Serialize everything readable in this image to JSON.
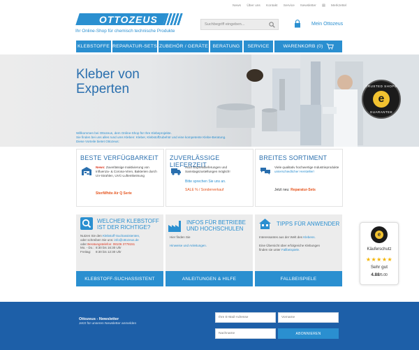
{
  "topnav": {
    "links": [
      "News",
      "Über uns",
      "Kontakt",
      "Service",
      "Newsletter"
    ],
    "merkzettel": "Merkzettel"
  },
  "logo": {
    "text": "OTTOZEUS"
  },
  "tagline": "Ihr Online-Shop für chemisch technische Produkte",
  "search": {
    "placeholder": "Suchbegriff eingeben..."
  },
  "account": {
    "label": "Mein Ottozeus"
  },
  "mainnav": {
    "items": [
      "KLEBSTOFFE",
      "REPARATUR-SETS",
      "ZUBEHÖR / GERÄTE",
      "BERATUNG",
      "SERVICE",
      "WARENKORB (0)"
    ]
  },
  "hero": {
    "title_line1": "Kleber von",
    "title_line2": "Experten",
    "text_line1": "Willkommen bei Ottozeus, dem Online-Shop für Ihre Klebeprojekte.",
    "text_line2": "Sie finden bei uns alles rund ums Kleben: Kleber, Klebstoffzubehör und eine kompetente Klebe-Beratung.",
    "text_line3": "Diese Vorteile bietet Ottozeus:"
  },
  "trusted_badge": {
    "top": "TRUSTED SHOPS",
    "bottom": "GUARANTEE",
    "mark": "e"
  },
  "cards": [
    {
      "title": "BESTE VERFÜGBARKEIT",
      "news_label": "News:",
      "body": "Zuverlässige Inaktivierung von Influenza- & Corona-Viren, Bakterien durch UV-Strahlen, UVC-Luftentkeimung",
      "link": "SteriWhite Air Q Serie"
    },
    {
      "title": "ZUVERLÄSSIGE LIEFERZEIT",
      "body": "Auch Expresslieferungen und Samstagszustellungen möglich!",
      "link1": "Bitte sprechen Sie uns an.",
      "link2": "SALE % / Sonderverkauf"
    },
    {
      "title": "BREITES SORTIMENT",
      "body": "Viele qualitativ hochwertige Industrieprodukte",
      "body_link": "unterschiedlicher Hersteller!",
      "now_label": "Jetzt neu:",
      "link": "Reparatur-Sets"
    }
  ],
  "panels": [
    {
      "title_line1": "WELCHER KLEBSTOFF",
      "title_line2": "IST DER RICHTIGE?",
      "line1_pre": "Nutzen Sie den",
      "line1_link": "Klebstoff-Suchassistenten,",
      "line2_pre": "oder schreiben Sie uns:",
      "line2_link": "info@ottozeus.de",
      "line3_pre": "oder",
      "line3_link": "Beratungstelefon: 08106 3778151",
      "hours1_label": "Mo. - Do.:",
      "hours1": "8:30 bis 16:30 Uhr",
      "hours2_label": "Freitag:",
      "hours2": "8:30 bis 12:30 Uhr",
      "button": "KLEBSTOFF-SUCHASSISTENT"
    },
    {
      "title_line1": "INFOS FÜR BETRIEBE",
      "title_line2": "UND HOCHSCHULEN",
      "line1": "Hier finden Sie",
      "line2_link": "Hinweise und Anleitungen.",
      "button": "ANLEITUNGEN & HILFE"
    },
    {
      "title_line1": "TIPPS FÜR ANWENDER",
      "line1_pre": "Interessantes aus der Welt des",
      "line1_link": "Klebens.",
      "line2": "Eine Übersicht über erfolgreiche Klebungen",
      "line3_pre": "finden sie unter",
      "line3_link": "Fallbeispiele.",
      "button": "FALLBEISPIELE"
    }
  ],
  "kaeuferschutz": {
    "label": "Käuferschutz",
    "stars": "★★★★★",
    "grade": "Sehr gut",
    "score": "4.88",
    "score_suffix": "/5.00"
  },
  "newsletter": {
    "title": "Ottozeus - Newsletter",
    "subtitle": "Jetzt für unseren Newsletter anmelden",
    "email_placeholder": "Ihre E-Mail-Adresse",
    "firstname_placeholder": "Vorname",
    "lastname_placeholder": "Nachname",
    "button": "ABONNIEREN"
  },
  "colors": {
    "brand_blue": "#2a8fd0",
    "footer_blue": "#1d5fa8",
    "accent_red": "#d9361f",
    "accent_orange": "#e5531c"
  }
}
